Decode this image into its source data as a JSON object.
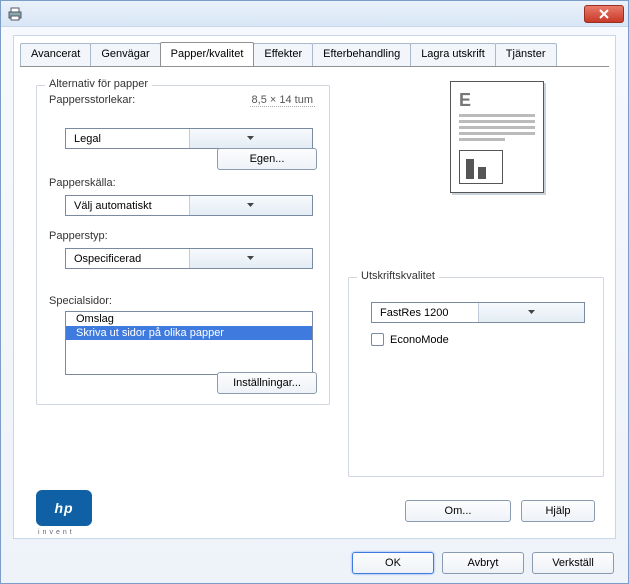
{
  "titlebar": {
    "title": ""
  },
  "tabs": {
    "items": [
      {
        "label": "Avancerat"
      },
      {
        "label": "Genvägar"
      },
      {
        "label": "Papper/kvalitet"
      },
      {
        "label": "Effekter"
      },
      {
        "label": "Efterbehandling"
      },
      {
        "label": "Lagra utskrift"
      },
      {
        "label": "Tjänster"
      }
    ],
    "active_index": 2
  },
  "paper": {
    "group_label": "Alternativ för papper",
    "size_label": "Pappersstorlekar:",
    "size_info": "8,5 × 14 tum",
    "size_value": "Legal",
    "custom_button": "Egen...",
    "source_label": "Papperskälla:",
    "source_value": "Välj automatiskt",
    "type_label": "Papperstyp:",
    "type_value": "Ospecificerad",
    "special_label": "Specialsidor:",
    "special_items": [
      {
        "label": "Omslag"
      },
      {
        "label": "Skriva ut sidor på olika papper"
      }
    ],
    "special_selected_index": 1,
    "settings_button": "Inställningar..."
  },
  "quality": {
    "group_label": "Utskriftskvalitet",
    "value": "FastRes 1200",
    "economode_label": "EconoMode",
    "economode_checked": false
  },
  "footer": {
    "about": "Om...",
    "help": "Hjälp",
    "ok": "OK",
    "cancel": "Avbryt",
    "apply": "Verkställ"
  },
  "logo": {
    "text": "hp",
    "sub": "invent"
  }
}
